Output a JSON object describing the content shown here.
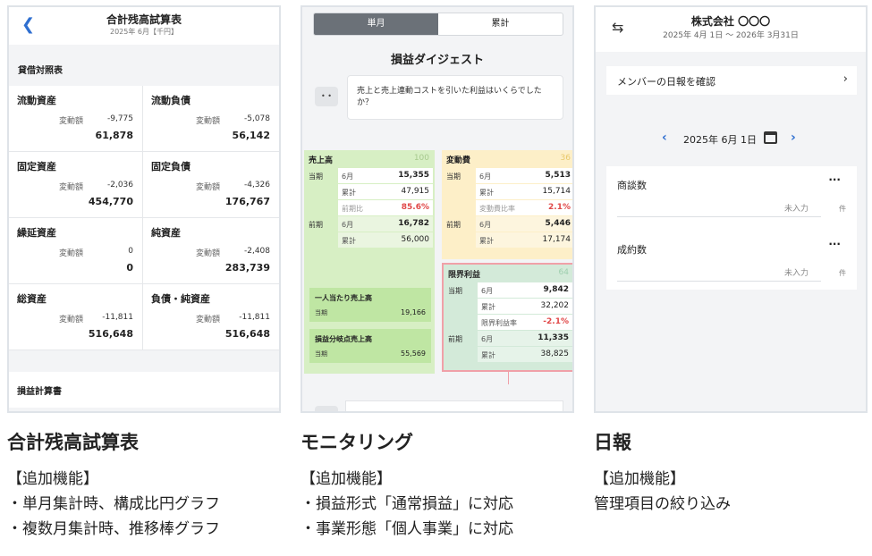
{
  "panel1": {
    "back_icon": "chevron-left-icon",
    "title": "合計残高試算表",
    "subtitle": "2025年 6月【千円】",
    "section_bs": "貸借対照表",
    "delta_label": "変動額",
    "cells": [
      {
        "label": "流動資産",
        "delta": "-9,775",
        "value": "61,878"
      },
      {
        "label": "流動負債",
        "delta": "-5,078",
        "value": "56,142"
      },
      {
        "label": "固定資産",
        "delta": "-2,036",
        "value": "454,770"
      },
      {
        "label": "固定負債",
        "delta": "-4,326",
        "value": "176,767"
      },
      {
        "label": "繰延資産",
        "delta": "0",
        "value": "0"
      },
      {
        "label": "純資産",
        "delta": "-2,408",
        "value": "283,739"
      },
      {
        "label": "総資産",
        "delta": "-11,811",
        "value": "516,648"
      },
      {
        "label": "負債・純資産",
        "delta": "-11,811",
        "value": "516,648"
      }
    ],
    "section_pl": "損益計算書"
  },
  "panel2": {
    "tabs": [
      "単月",
      "累計"
    ],
    "digest_title": "損益ダイジェスト",
    "bot_icon": "robot-icon",
    "bot_text": "売上と売上連動コストを引いた利益はいくらでしたか？",
    "sales": {
      "title": "売上高",
      "index": "100",
      "current_label": "当期",
      "prev_label": "前期",
      "rows": [
        {
          "c1": "当期",
          "c2": "6月",
          "c3": "15,355"
        },
        {
          "c1": "",
          "c2": "累計",
          "c3": "47,915"
        },
        {
          "c1": "",
          "c2": "前期比",
          "c3": "85.6%"
        },
        {
          "c1": "前期",
          "c2": "6月",
          "c3": "16,782"
        },
        {
          "c1": "",
          "c2": "累計",
          "c3": "56,000"
        }
      ]
    },
    "variable": {
      "title": "変動費",
      "index": "36",
      "rows": [
        {
          "c1": "当期",
          "c2": "6月",
          "c3": "5,513"
        },
        {
          "c1": "",
          "c2": "累計",
          "c3": "15,714"
        },
        {
          "c1": "",
          "c2": "変動費比率",
          "c3": "2.1%"
        },
        {
          "c1": "前期",
          "c2": "6月",
          "c3": "5,446"
        },
        {
          "c1": "",
          "c2": "累計",
          "c3": "17,174"
        }
      ]
    },
    "limit": {
      "title": "限界利益",
      "index": "64",
      "rows": [
        {
          "c1": "当期",
          "c2": "6月",
          "c3": "9,842"
        },
        {
          "c1": "",
          "c2": "累計",
          "c3": "32,202"
        },
        {
          "c1": "",
          "c2": "限界利益率",
          "c3": "-2.1%"
        },
        {
          "c1": "前期",
          "c2": "6月",
          "c3": "11,335"
        },
        {
          "c1": "",
          "c2": "累計",
          "c3": "38,825"
        }
      ]
    },
    "per_person": {
      "title": "一人当たり売上高",
      "label": "当期",
      "value": "19,166"
    },
    "breakeven": {
      "title": "損益分岐点売上高",
      "label": "当期",
      "value": "55,569"
    }
  },
  "panel3": {
    "swap_icon": "swap-arrows-icon",
    "company": "株式会社 〇〇〇",
    "period": "2025年 4月 1日 〜 2026年 3月31日",
    "member_link": "メンバーの日報を確認",
    "chevron": "›",
    "date": "2025年 6月 1日",
    "prev": "‹",
    "next": "›",
    "items": [
      {
        "name": "商談数",
        "placeholder": "未入力",
        "unit": "件"
      },
      {
        "name": "成約数",
        "placeholder": "未入力",
        "unit": "件"
      }
    ],
    "more": "···"
  },
  "captions": [
    {
      "title": "合計残高試算表",
      "tag": "【追加機能】",
      "lines": [
        "・単月集計時、構成比円グラフ",
        "・複数月集計時、推移棒グラフ"
      ]
    },
    {
      "title": "モニタリング",
      "tag": "【追加機能】",
      "lines": [
        "・損益形式「通常損益」に対応",
        "・事業形態「個人事業」に対応"
      ]
    },
    {
      "title": "日報",
      "tag": "【追加機能】",
      "lines": [
        "管理項目の絞り込み"
      ]
    }
  ]
}
